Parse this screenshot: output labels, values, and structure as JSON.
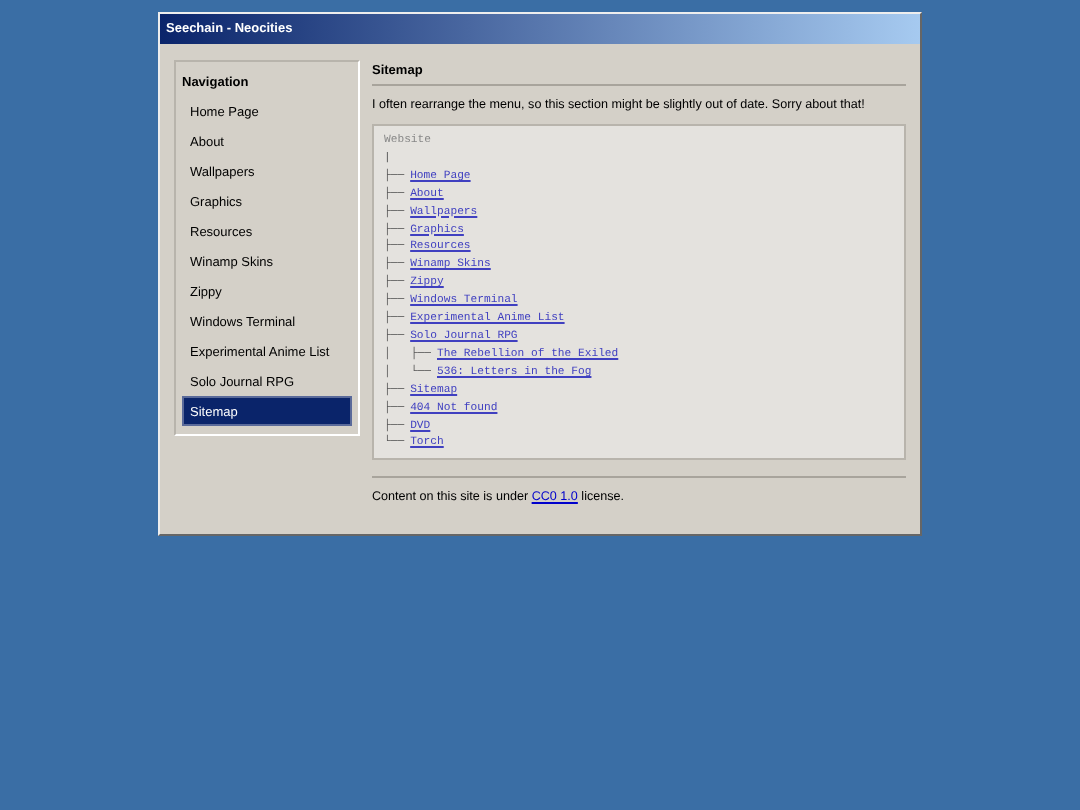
{
  "window": {
    "title": "Seechain - Neocities"
  },
  "sidebar": {
    "heading": "Navigation",
    "items": [
      {
        "label": "Home Page",
        "selected": false
      },
      {
        "label": "About",
        "selected": false
      },
      {
        "label": "Wallpapers",
        "selected": false
      },
      {
        "label": "Graphics",
        "selected": false
      },
      {
        "label": "Resources",
        "selected": false
      },
      {
        "label": "Winamp Skins",
        "selected": false
      },
      {
        "label": "Zippy",
        "selected": false
      },
      {
        "label": "Windows Terminal",
        "selected": false
      },
      {
        "label": "Experimental Anime List",
        "selected": false
      },
      {
        "label": "Solo Journal RPG",
        "selected": false
      },
      {
        "label": "Sitemap",
        "selected": true
      }
    ]
  },
  "main": {
    "heading": "Sitemap",
    "intro": "I often rearrange the menu, so this section might be slightly out of date. Sorry about that!",
    "tree": {
      "root": "Website",
      "spacer": "|",
      "items": [
        {
          "prefix": "├──",
          "label": "Home Page"
        },
        {
          "prefix": "├──",
          "label": "About"
        },
        {
          "prefix": "├──",
          "label": "Wallpapers"
        },
        {
          "prefix": "├──",
          "label": "Graphics"
        },
        {
          "prefix": "├──",
          "label": "Resources"
        },
        {
          "prefix": "├──",
          "label": "Winamp Skins"
        },
        {
          "prefix": "├──",
          "label": "Zippy"
        },
        {
          "prefix": "├──",
          "label": "Windows Terminal"
        },
        {
          "prefix": "├──",
          "label": "Experimental Anime List"
        },
        {
          "prefix": "├──",
          "label": "Solo Journal RPG",
          "children": [
            {
              "prefix": "│   ├──",
              "label": "The Rebellion of the Exiled"
            },
            {
              "prefix": "│   └──",
              "label": "536: Letters in the Fog"
            }
          ]
        },
        {
          "prefix": "├──",
          "label": "Sitemap"
        },
        {
          "prefix": "├──",
          "label": "404 Not found"
        },
        {
          "prefix": "├──",
          "label": "DVD"
        },
        {
          "prefix": "└──",
          "label": "Torch"
        }
      ]
    },
    "footer": {
      "before": "Content on this site is under",
      "link": "CC0 1.0",
      "after": "license."
    }
  }
}
